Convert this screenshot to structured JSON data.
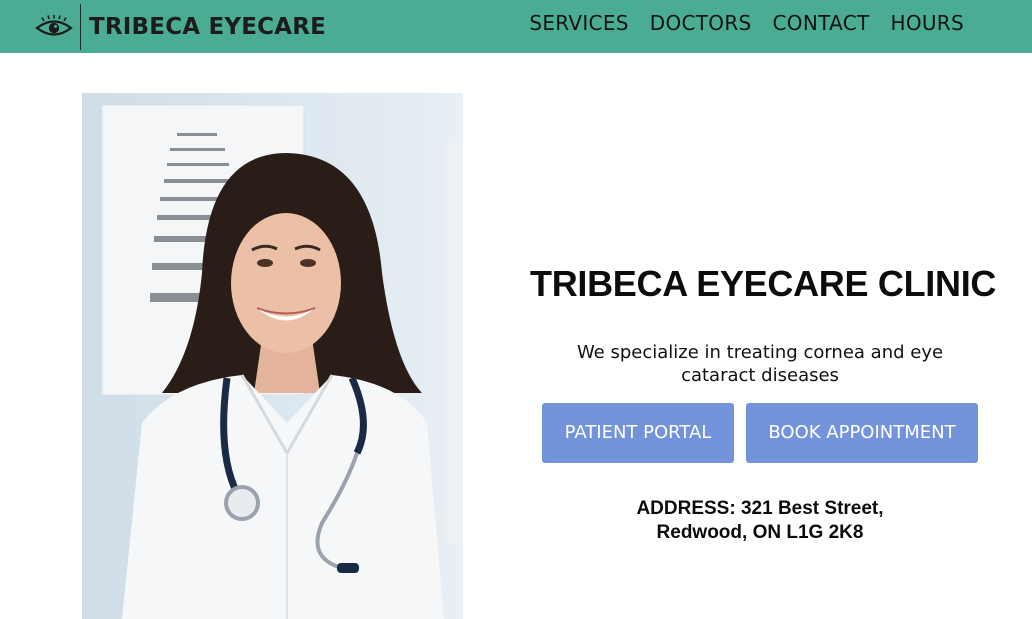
{
  "header": {
    "brand_name": "TRIBECA EYECARE",
    "brand_icon": "eye-icon",
    "nav": [
      {
        "label": "SERVICES"
      },
      {
        "label": "DOCTORS"
      },
      {
        "label": "CONTACT"
      },
      {
        "label": "HOURS"
      }
    ]
  },
  "hero": {
    "photo_alt": "Smiling doctor in white coat with stethoscope in front of an eye chart",
    "title": "TRIBECA EYECARE CLINIC",
    "tagline": "We specialize in treating cornea and eye cataract diseases",
    "buttons": {
      "patient_portal": "PATIENT PORTAL",
      "book_appointment": "BOOK APPOINTMENT"
    },
    "address": "ADDRESS: 321 Best Street, Redwood, ON L1G 2K8"
  },
  "colors": {
    "header_bg": "#4aad93",
    "button_bg": "#7393db",
    "text": "#111111"
  }
}
